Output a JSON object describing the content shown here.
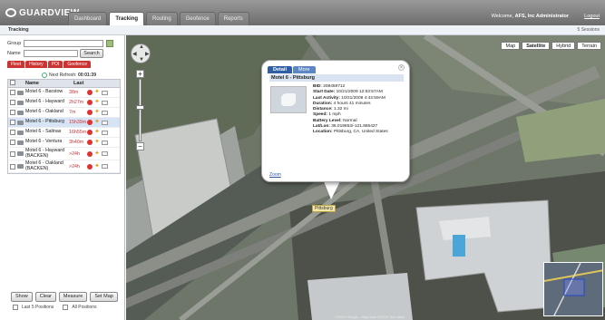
{
  "header": {
    "logo": "GUARDVIEW",
    "tabs": [
      "Dashboard",
      "Tracking",
      "Routing",
      "Geofence",
      "Reports"
    ],
    "active_tab": "Tracking",
    "welcome_prefix": "Welcome,",
    "user": "AFS, Inc Administrator",
    "logout": "Logout"
  },
  "subheader": {
    "title": "Tracking",
    "session": "5 Sessions"
  },
  "filters": {
    "group_label": "Group",
    "name_label": "Name",
    "search_button": "Search"
  },
  "panel_tabs": [
    "Fleet",
    "History",
    "POI",
    "Geofence"
  ],
  "next_refresh": {
    "label": "Next Refresh:",
    "value": "00:01:39"
  },
  "table": {
    "columns": [
      "Name",
      "Last"
    ],
    "rows": [
      {
        "name": "Motel 6 - Barstow",
        "last": "38m"
      },
      {
        "name": "Motel 6 - Hayward",
        "last": "2h27m"
      },
      {
        "name": "Motel 6 - Oakland",
        "last": "7m"
      },
      {
        "name": "Motel 6 - Pittsburg",
        "last": "15h39m"
      },
      {
        "name": "Motel 6 - Salinas",
        "last": "16h55m"
      },
      {
        "name": "Motel 6 - Ventura",
        "last": "3h40m"
      },
      {
        "name": "Motel 6 - Hayward (BACKEN)",
        "last": ">24h"
      },
      {
        "name": "Motel 6 - Oakland (BACKEN)",
        "last": ">24h"
      }
    ]
  },
  "panel_buttons": [
    "Show",
    "Clear",
    "Measure",
    "Set Map"
  ],
  "options": [
    "Last 5 Positions",
    "All Positions"
  ],
  "map": {
    "types": [
      "Map",
      "Satellite",
      "Hybrid",
      "Terrain"
    ],
    "active_type": "Satellite",
    "vehicle_label": "Pittsburg",
    "copyright": "©2009 Google - Map data ©2009 Tele Atlas"
  },
  "popup": {
    "tabs": [
      "Detail",
      "More"
    ],
    "title": "Motel 6 - Pittsburg",
    "fields": [
      {
        "label": "BID:",
        "value": "208459712"
      },
      {
        "label": "Start Date:",
        "value": "10/21/2009 12:53:57AM"
      },
      {
        "label": "Last Activity:",
        "value": "10/21/2009 4:44:59AM"
      },
      {
        "label": "Duration:",
        "value": "4 hours 41 minutes"
      },
      {
        "label": "Distance:",
        "value": "1.32 mi"
      },
      {
        "label": "Speed:",
        "value": "1 mph"
      },
      {
        "label": "Battery Level:",
        "value": "Normal"
      },
      {
        "label": "Lat/Lon:",
        "value": "38.019653/-121.885427"
      },
      {
        "label": "Location:",
        "value": "Pittsburg, CA, United States"
      }
    ],
    "zoom_link": "Zoom"
  }
}
